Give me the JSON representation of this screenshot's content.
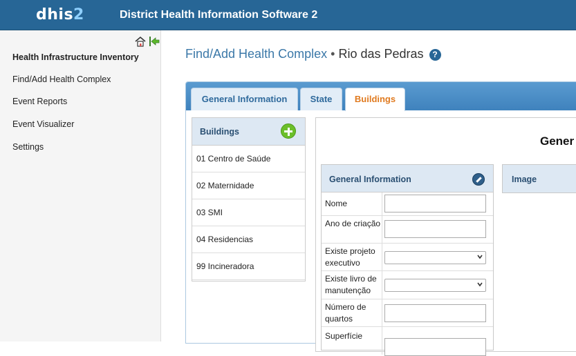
{
  "header": {
    "logo_main": "dhis",
    "logo_num": "2",
    "app_title": "District Health Information Software 2"
  },
  "sidebar": {
    "icons": [
      "home-icon",
      "back-arrow-icon"
    ],
    "items": [
      {
        "label": "Health Infrastructure Inventory"
      },
      {
        "label": "Find/Add Health Complex"
      },
      {
        "label": "Event Reports"
      },
      {
        "label": "Event Visualizer"
      },
      {
        "label": "Settings"
      }
    ]
  },
  "page": {
    "title_link": "Find/Add Health Complex",
    "separator": "•",
    "complex_name": "Rio das Pedras",
    "help_glyph": "?"
  },
  "tabs": [
    {
      "label": "General Information",
      "active": false
    },
    {
      "label": "State",
      "active": false
    },
    {
      "label": "Buildings",
      "active": true
    }
  ],
  "buildings": {
    "header": "Buildings",
    "items": [
      "01 Centro de Saúde",
      "02 Maternidade",
      "03 SMI",
      "04 Residencias",
      "99 Incineradora"
    ]
  },
  "form": {
    "section_title": "Gener",
    "general_info": {
      "header": "General Information",
      "fields": [
        {
          "label": "Nome",
          "type": "text",
          "value": ""
        },
        {
          "label": "Ano de criação",
          "type": "text",
          "value": ""
        },
        {
          "label": "Existe projeto executivo",
          "type": "select",
          "value": ""
        },
        {
          "label": "Existe livro de manutenção",
          "type": "select",
          "value": ""
        },
        {
          "label": "Número de quartos",
          "type": "text",
          "value": ""
        },
        {
          "label": "Superfície",
          "type": "text",
          "value": ""
        }
      ]
    },
    "image_panel": {
      "header": "Image"
    }
  },
  "colors": {
    "header_bg": "#276696",
    "active_tab_text": "#e07a1f",
    "link": "#3b78a8",
    "add_button": "#6cbf2a"
  }
}
